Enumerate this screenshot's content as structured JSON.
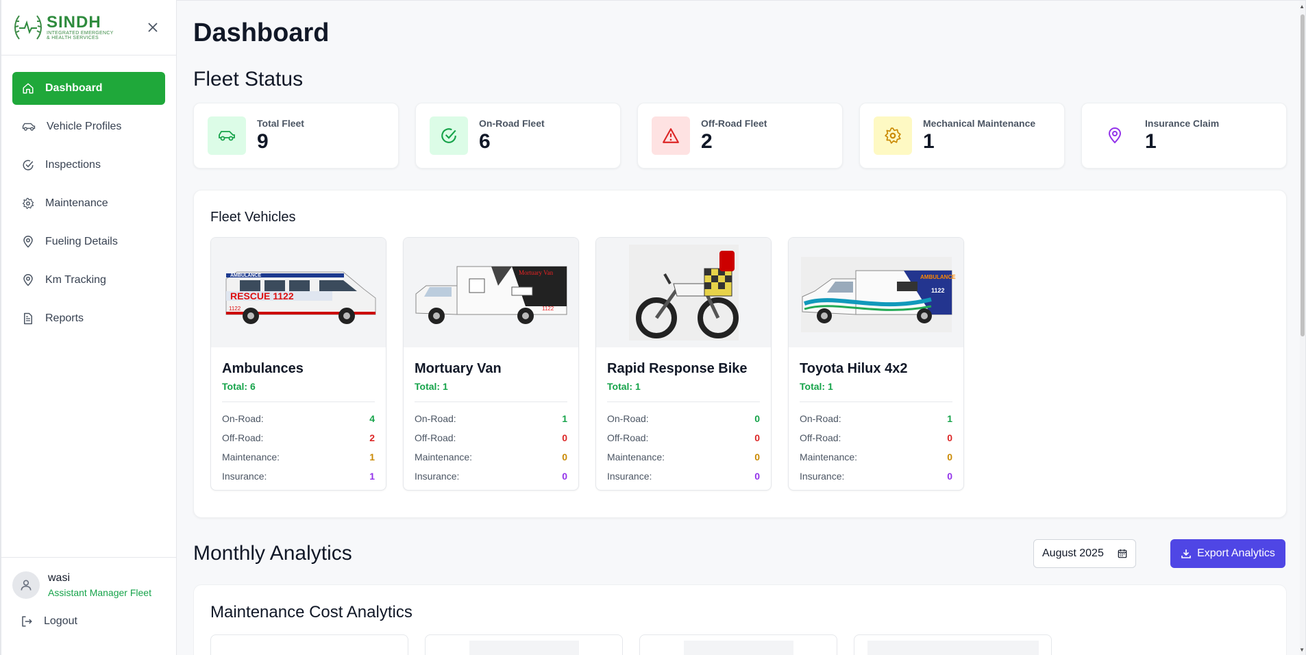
{
  "brand": {
    "name": "SINDH",
    "subtitle_line1": "INTEGRATED EMERGENCY",
    "subtitle_line2": "& HEALTH SERVICES"
  },
  "sidebar": {
    "items": [
      {
        "label": "Dashboard",
        "icon": "home-icon",
        "active": true
      },
      {
        "label": "Vehicle Profiles",
        "icon": "car-icon"
      },
      {
        "label": "Inspections",
        "icon": "check-circle-icon"
      },
      {
        "label": "Maintenance",
        "icon": "gear-icon"
      },
      {
        "label": "Fueling Details",
        "icon": "map-pin-icon"
      },
      {
        "label": "Km Tracking",
        "icon": "map-pin-icon"
      },
      {
        "label": "Reports",
        "icon": "document-icon"
      }
    ],
    "user": {
      "name": "wasi",
      "role": "Assistant Manager Fleet"
    },
    "logout_label": "Logout"
  },
  "page": {
    "title": "Dashboard",
    "fleet_status_title": "Fleet Status",
    "stats": [
      {
        "label": "Total Fleet",
        "value": "9",
        "icon": "car-icon",
        "bg": "#dcfce7",
        "color": "#16a34a"
      },
      {
        "label": "On-Road Fleet",
        "value": "6",
        "icon": "check-circle-icon",
        "bg": "#dcfce7",
        "color": "#16a34a"
      },
      {
        "label": "Off-Road Fleet",
        "value": "2",
        "icon": "warning-icon",
        "bg": "#fee2e2",
        "color": "#dc2626"
      },
      {
        "label": "Mechanical Maintenance",
        "value": "1",
        "icon": "gear-icon",
        "bg": "#fef9c3",
        "color": "#ca8a04"
      },
      {
        "label": "Insurance Claim",
        "value": "1",
        "icon": "map-pin-icon",
        "bg": "#ffffff",
        "color": "#9333ea"
      }
    ],
    "fleet_vehicles_title": "Fleet Vehicles",
    "vehicles": [
      {
        "name": "Ambulances",
        "total": "Total: 6",
        "on_road": "4",
        "off_road": "2",
        "maintenance": "1",
        "insurance": "1",
        "image": "ambulance-van-image"
      },
      {
        "name": "Mortuary Van",
        "total": "Total: 1",
        "on_road": "1",
        "off_road": "0",
        "maintenance": "0",
        "insurance": "0",
        "image": "mortuary-van-image"
      },
      {
        "name": "Rapid Response Bike",
        "total": "Total: 1",
        "on_road": "0",
        "off_road": "0",
        "maintenance": "0",
        "insurance": "0",
        "image": "motorbike-image"
      },
      {
        "name": "Toyota Hilux 4x2",
        "total": "Total: 1",
        "on_road": "1",
        "off_road": "0",
        "maintenance": "0",
        "insurance": "0",
        "image": "pickup-ambulance-image"
      }
    ],
    "row_labels": {
      "on_road": "On-Road:",
      "off_road": "Off-Road:",
      "maintenance": "Maintenance:",
      "insurance": "Insurance:"
    },
    "vehicle_image_text": {
      "ambulance_top": "AMBULANCE",
      "ambulance_side": "RESCUE 1122",
      "ambulance_num": "1122",
      "mortuary_label": "Mortuary Van",
      "mortuary_num": "1122",
      "hilux_label": "AMBULANCE",
      "hilux_num": "1122"
    },
    "monthly_analytics_title": "Monthly Analytics",
    "month_value": "August  2025",
    "export_label": "Export Analytics",
    "maintenance_cost_title": "Maintenance Cost Analytics"
  }
}
